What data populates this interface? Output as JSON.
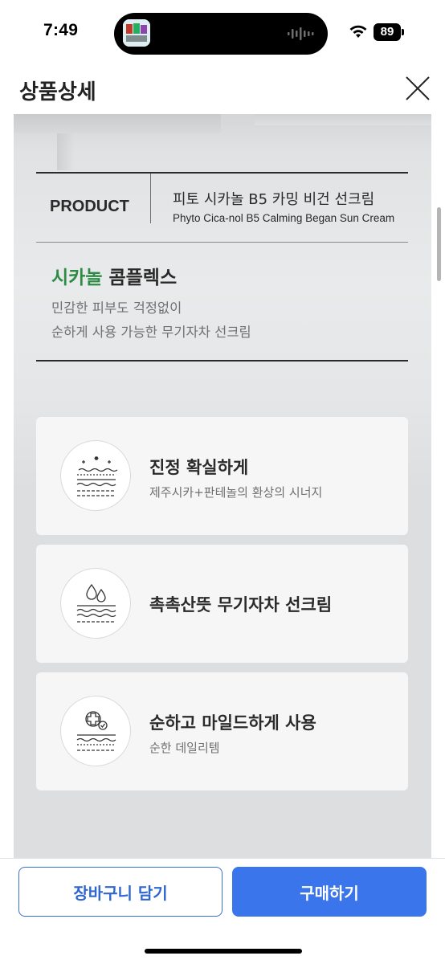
{
  "status_bar": {
    "time": "7:49",
    "battery": "89",
    "icons": [
      "app-thumbnail-icon",
      "audio-wave-icon",
      "wifi-icon",
      "battery-icon"
    ]
  },
  "header": {
    "title": "상품상세",
    "close_icon": "close-icon"
  },
  "product": {
    "label": "PRODUCT",
    "name_kr": "피토 시카놀 B5 카밍 비건 선크림",
    "name_en": "Phyto Cica-nol B5 Calming Began Sun Cream"
  },
  "intro": {
    "headline_highlight": "시카놀",
    "headline_rest": " 콤플렉스",
    "desc_line1": "민감한 피부도 걱정없이",
    "desc_line2": "순하게 사용 가능한 무기자차 선크림"
  },
  "features": [
    {
      "title": "진정 확실하게",
      "subtitle": "제주시카+판테놀의 환상의 시너지",
      "icon": "sparkle-skin-icon"
    },
    {
      "title": "촉촉산뜻 무기자차 선크림",
      "subtitle": "",
      "icon": "water-drops-skin-icon"
    },
    {
      "title": "순하고 마일드하게 사용",
      "subtitle": "순한 데일리템",
      "icon": "medical-cross-check-skin-icon"
    }
  ],
  "actions": {
    "cart_label": "장바구니 담기",
    "buy_label": "구매하기"
  },
  "colors": {
    "accent_green": "#2e8b46",
    "primary_blue": "#3a75ec"
  }
}
